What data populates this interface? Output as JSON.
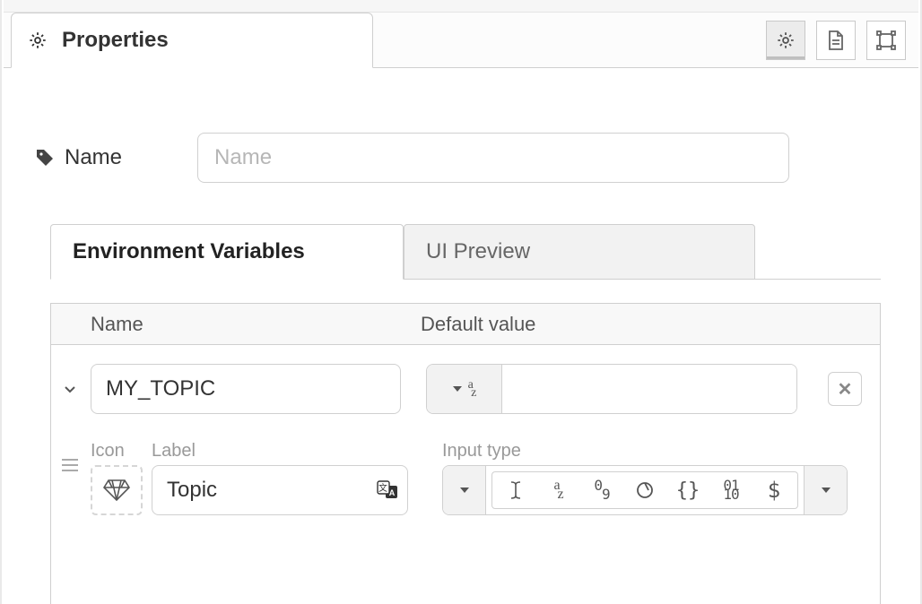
{
  "header": {
    "tab_title": "Properties"
  },
  "name_field": {
    "label": "Name",
    "placeholder": "Name",
    "value": ""
  },
  "subtabs": {
    "env": "Environment Variables",
    "preview": "UI Preview"
  },
  "table": {
    "col_name": "Name",
    "col_default": "Default value"
  },
  "variable": {
    "name": "MY_TOPIC",
    "default_value": "",
    "icon_label": "Icon",
    "label_label": "Label",
    "label_value": "Topic",
    "input_type_label": "Input type"
  }
}
